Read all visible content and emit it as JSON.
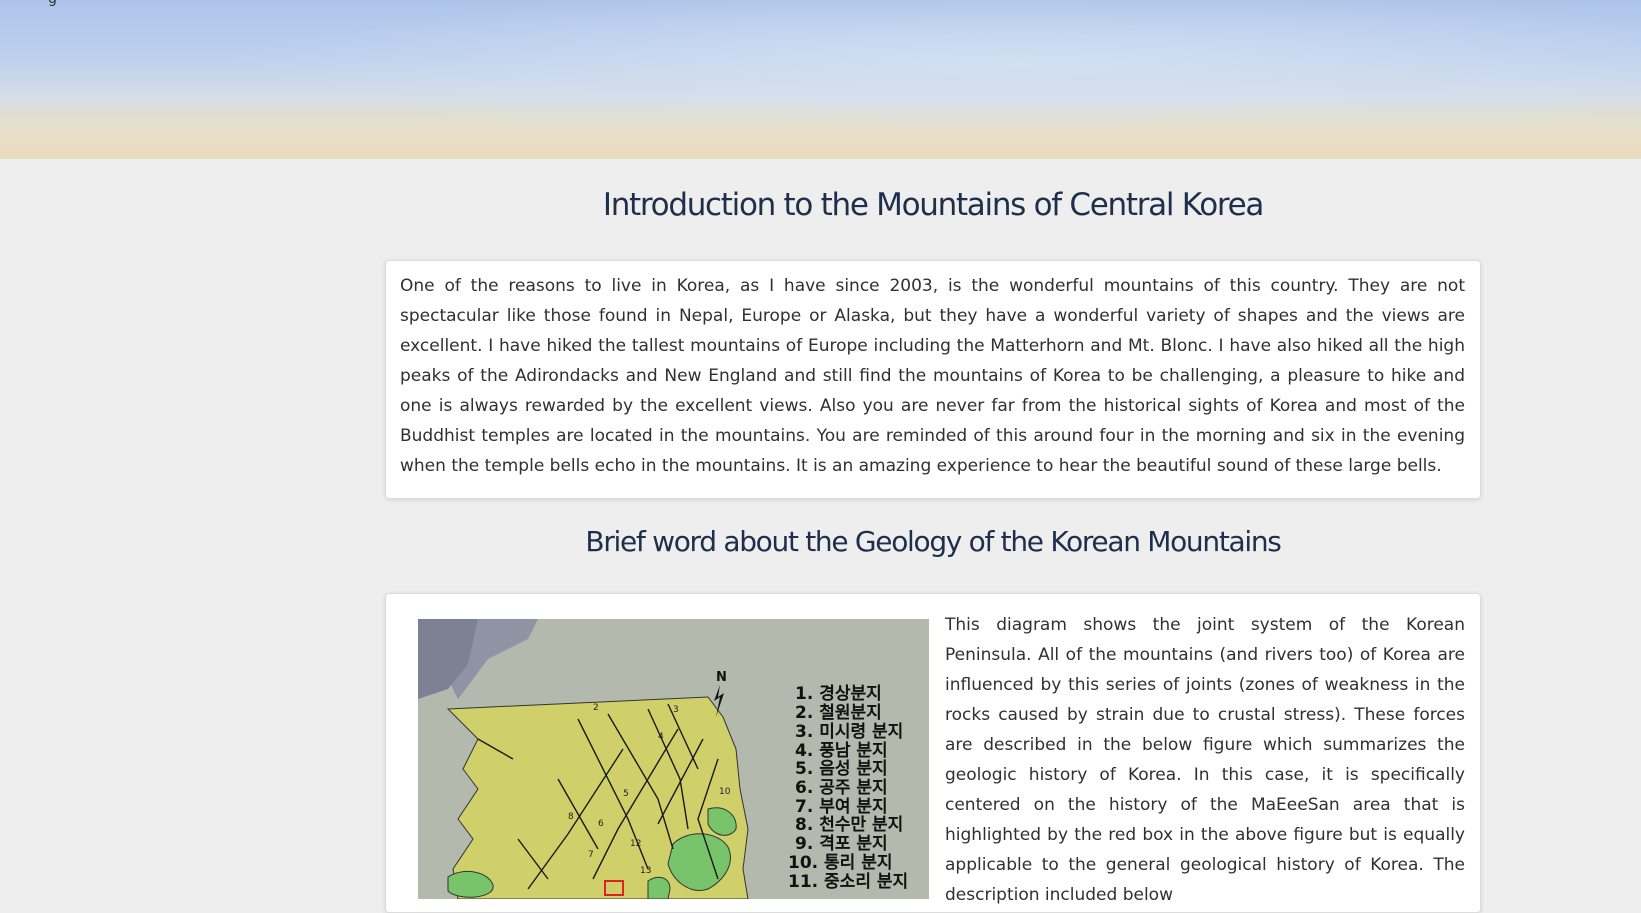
{
  "hero": {
    "corner_text": "g"
  },
  "main": {
    "title": "Introduction to the Mountains of Central Korea",
    "intro_paragraph": "One of the reasons to live in Korea, as I have since 2003, is the wonderful mountains of this country. They are not spectacular like those found in Nepal, Europe or Alaska, but they have a wonderful variety of shapes and the views are excellent. I have hiked the tallest mountains of Europe including the Matterhorn and Mt. Blonc. I have also hiked all the high peaks of the Adirondacks and New England and still find the mountains of Korea to be challenging, a pleasure to hike and one is always rewarded by the excellent views. Also you are never far from the historical sights of Korea and most of the Buddhist temples are located in the mountains. You are reminded of this around four in the morning and six in the evening when the temple bells echo in the mountains. It is an amazing experience to hear the beautiful sound of these large bells.",
    "geology_title": "Brief word about the Geology of the Korean Mountains",
    "geology_paragraph": "This diagram shows the joint system of the Korean Peninsula. All of the mountains (and rivers too) of Korea are influenced by this series of joints (zones of weakness in the rocks caused by strain due to crustal stress). These forces are described in the below figure which summarizes the geologic history of Korea. In this case, it is specifically centered on the history of the MaEeeSan area that is highlighted by the red box in the above figure but is equally applicable to the general geological history of Korea. The description included below"
  },
  "figure": {
    "north_label": "N",
    "legend": [
      "1. 경상분지",
      "2. 철원분지",
      "3. 미시령 분지",
      "4. 풍남 분지",
      "5. 음성 분지",
      "6. 공주 분지",
      "7. 부여 분지",
      "8. 천수만 분지",
      "9. 격포 분지",
      "10. 통리 분지",
      "11. 중소리 분지"
    ],
    "map_numbers": [
      "2",
      "3",
      "4",
      "5",
      "6",
      "7",
      "8",
      "10",
      "12",
      "13"
    ],
    "colors": {
      "sea": "#b3b9ad",
      "land": "#cfd06a",
      "basin": "#78c46a",
      "sea_channel": "#8f93a3",
      "highlight_box": "#dd2222"
    }
  }
}
